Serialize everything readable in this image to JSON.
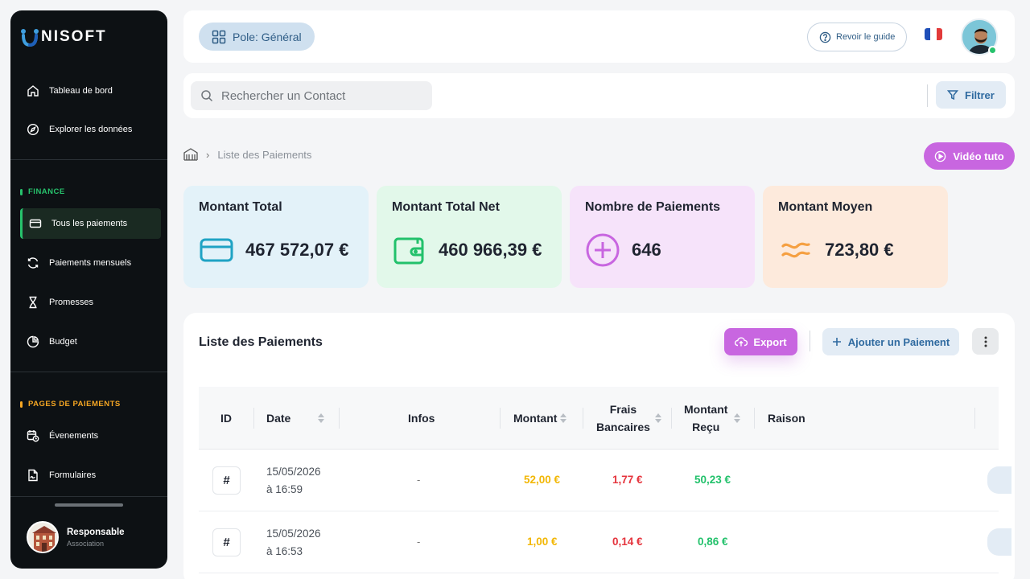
{
  "brand": {
    "name": "NISOFT"
  },
  "sidebar": {
    "items_top": [
      {
        "label": "Tableau de bord",
        "icon": "home-icon"
      },
      {
        "label": "Explorer les données",
        "icon": "compass-icon"
      }
    ],
    "finance_label": "FINANCE",
    "finance_color": "#27c26c",
    "finance_items": [
      {
        "label": "Tous les paiements",
        "icon": "credit-card-icon",
        "active": true
      },
      {
        "label": "Paiements mensuels",
        "icon": "refresh-icon"
      },
      {
        "label": "Promesses",
        "icon": "hourglass-icon"
      },
      {
        "label": "Budget",
        "icon": "pie-chart-icon"
      }
    ],
    "pages_label": "PAGES DE PAIEMENTS",
    "pages_color": "#f5a623",
    "pages_items": [
      {
        "label": "Évenements",
        "icon": "calendar-clock-icon"
      },
      {
        "label": "Formulaires",
        "icon": "file-signature-icon"
      }
    ],
    "profile": {
      "name": "Responsable",
      "role": "Association"
    }
  },
  "topbar": {
    "pole_label": "Pole: Général",
    "guide_label": "Revoir le guide",
    "flag": "fr"
  },
  "search": {
    "placeholder": "Rechercher un Contact",
    "filter_label": "Filtrer"
  },
  "breadcrumb": {
    "current": "Liste des Paiements"
  },
  "video_label": "Vidéo tuto",
  "stats": [
    {
      "title": "Montant Total",
      "value": "467 572,07 €",
      "icon": "credit-card-icon",
      "bg": "#e3f2f9",
      "color": "#1fa3c4"
    },
    {
      "title": "Montant Total Net",
      "value": "460 966,39 €",
      "icon": "wallet-icon",
      "bg": "#e2f8ea",
      "color": "#22c16b"
    },
    {
      "title": "Nombre de Paiements",
      "value": "646",
      "icon": "plus-circle-icon",
      "bg": "#f6e3fa",
      "color": "#c866e0"
    },
    {
      "title": "Montant Moyen",
      "value": "723,80 €",
      "icon": "approx-icon",
      "bg": "#fdeadc",
      "color": "#f5a042"
    }
  ],
  "table": {
    "title": "Liste des Paiements",
    "export_label": "Export",
    "add_label": "Ajouter un Paiement",
    "columns": {
      "id": "ID",
      "date": "Date",
      "infos": "Infos",
      "montant": "Montant",
      "frais_1": "Frais",
      "frais_2": "Bancaires",
      "recu_1": "Montant",
      "recu_2": "Reçu",
      "raison": "Raison"
    },
    "rows": [
      {
        "id": "#",
        "date_1": "15/05/2026",
        "date_2": "à 16:59",
        "infos": "-",
        "montant": "52,00 €",
        "frais": "1,77 €",
        "recu": "50,23 €"
      },
      {
        "id": "#",
        "date_1": "15/05/2026",
        "date_2": "à 16:53",
        "infos": "-",
        "montant": "1,00 €",
        "frais": "0,14 €",
        "recu": "0,86 €"
      }
    ]
  }
}
